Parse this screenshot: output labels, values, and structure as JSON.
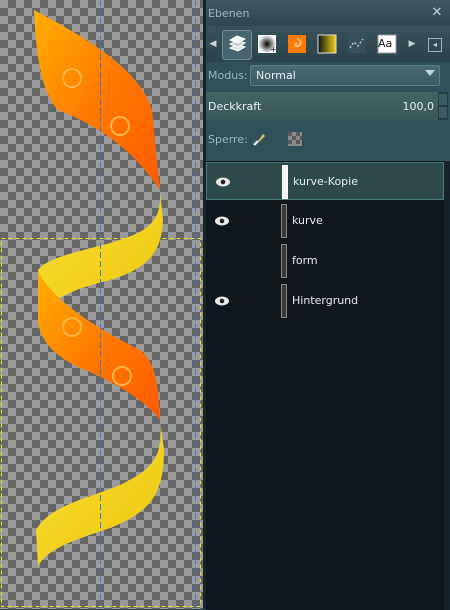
{
  "panel": {
    "title": "Ebenen",
    "close_icon": "close-x",
    "tabs": [
      {
        "name": "layers-tab",
        "icon": "layers-icon",
        "active": true
      },
      {
        "name": "channels-tab",
        "icon": "channels-icon"
      },
      {
        "name": "paths-tab",
        "icon": "paths-icon"
      },
      {
        "name": "gradients-tab",
        "icon": "gradient-icon"
      },
      {
        "name": "selection-tab",
        "icon": "selection-icon"
      },
      {
        "name": "text-tab",
        "icon": "text-icon"
      }
    ],
    "text_tab_label": "Aa"
  },
  "options": {
    "mode_label": "Modus:",
    "mode_value": "Normal",
    "opacity_label": "Deckkraft",
    "opacity_value": "100,0",
    "lock_label": "Sperre:"
  },
  "layers": [
    {
      "name": "kurve-Kopie",
      "visible": true,
      "selected": true,
      "thumb": "white"
    },
    {
      "name": "kurve",
      "visible": true,
      "selected": false,
      "thumb": "dark"
    },
    {
      "name": "form",
      "visible": false,
      "selected": false,
      "thumb": "dark"
    },
    {
      "name": "Hintergrund",
      "visible": true,
      "selected": false,
      "thumb": "dark"
    }
  ],
  "colors": {
    "ribbon_orange": "#ff7a00",
    "ribbon_yellow": "#f5d318",
    "guide_blue": "#3d7bd6",
    "selection_yellow": "#e8e020"
  }
}
